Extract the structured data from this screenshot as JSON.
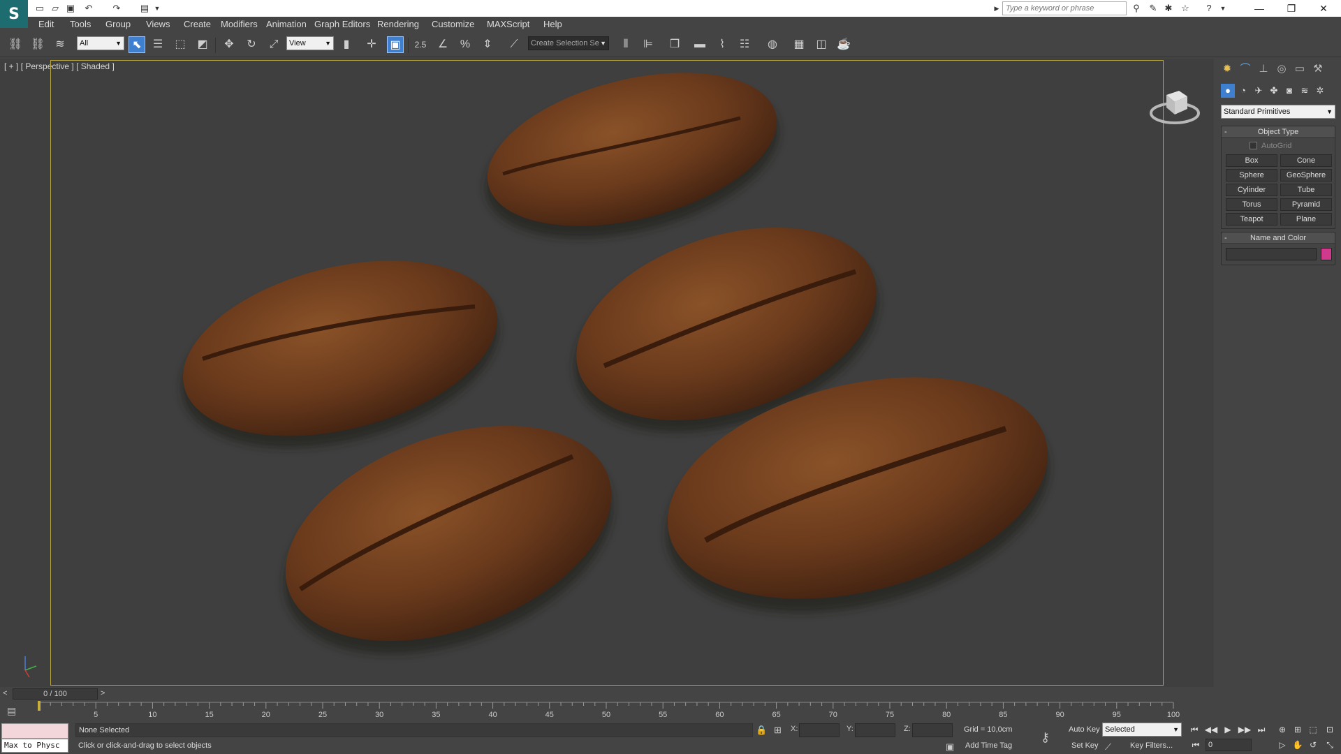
{
  "titlebar": {
    "search_placeholder": "Type a keyword or phrase"
  },
  "menu": [
    "Edit",
    "Tools",
    "Group",
    "Views",
    "Create",
    "Modifiers",
    "Animation",
    "Graph Editors",
    "Rendering",
    "Customize",
    "MAXScript",
    "Help"
  ],
  "toolbar": {
    "selection_filter": "All",
    "reference_coord": "View",
    "named_selection_placeholder": "Create Selection Se",
    "snap_value": "2.5"
  },
  "viewport": {
    "label_plus": "[ + ]",
    "label_view": "[ Perspective ]",
    "label_shading": "[ Shaded ]"
  },
  "command_panel": {
    "category": "Standard Primitives",
    "object_type_title": "Object Type",
    "autogrid_label": "AutoGrid",
    "buttons": [
      "Box",
      "Cone",
      "Sphere",
      "GeoSphere",
      "Cylinder",
      "Tube",
      "Torus",
      "Pyramid",
      "Teapot",
      "Plane"
    ],
    "name_color_title": "Name and Color",
    "swatch_color": "#d03a8c"
  },
  "timeslider": {
    "prev": "<",
    "position": "0 / 100",
    "next": ">"
  },
  "trackbar": {
    "ticks": [
      "5",
      "10",
      "15",
      "20",
      "25",
      "30",
      "35",
      "40",
      "45",
      "50",
      "55",
      "60",
      "65",
      "70",
      "75",
      "80",
      "85",
      "90",
      "95",
      "100"
    ]
  },
  "status": {
    "listener_text": "Max to Physc",
    "selection": "None Selected",
    "prompt": "Click or click-and-drag to select objects",
    "x_label": "X:",
    "y_label": "Y:",
    "z_label": "Z:",
    "grid": "Grid = 10,0cm",
    "add_time_tag": "Add Time Tag",
    "auto_key": "Auto Key",
    "set_key": "Set Key",
    "selected_mode": "Selected",
    "key_filters": "Key Filters...",
    "current_frame": "0"
  }
}
